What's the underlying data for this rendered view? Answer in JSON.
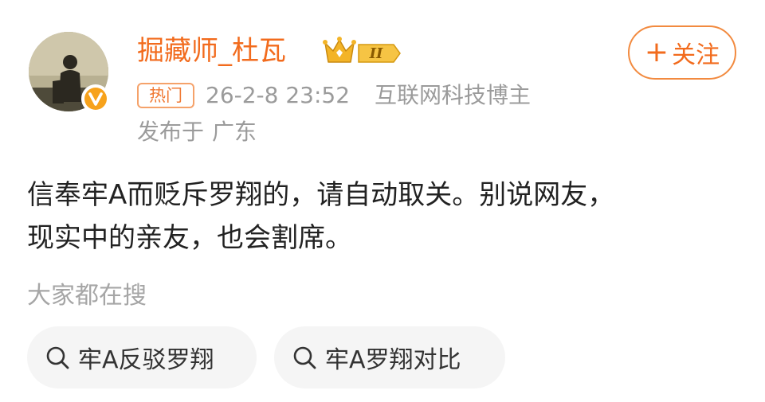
{
  "author": {
    "name": "掘藏师_杜瓦",
    "level_badge": "II",
    "verified": true
  },
  "follow_button": {
    "label": "关注"
  },
  "meta": {
    "hot_label": "热门",
    "timestamp": "26-2-8 23:52",
    "category": "互联网科技博主",
    "location_prefix": "发布于",
    "location": "广东"
  },
  "post": {
    "lines": [
      "信奉牢A而贬斥罗翔的，请自动取关。别说网友，",
      "现实中的亲友，也会割席。"
    ]
  },
  "search": {
    "heading": "大家都在搜",
    "suggestions": [
      {
        "label": "牢A反驳罗翔"
      },
      {
        "label": "牢A罗翔对比"
      }
    ]
  },
  "colors": {
    "brand_orange": "#f26b1d",
    "badge_orange": "#f7a21b",
    "meta_gray": "#9b9b9b",
    "chip_bg": "#f5f5f5"
  },
  "icons": [
    "avatar",
    "verified-v-icon",
    "crown-level-icon",
    "plus-icon",
    "search-icon"
  ]
}
